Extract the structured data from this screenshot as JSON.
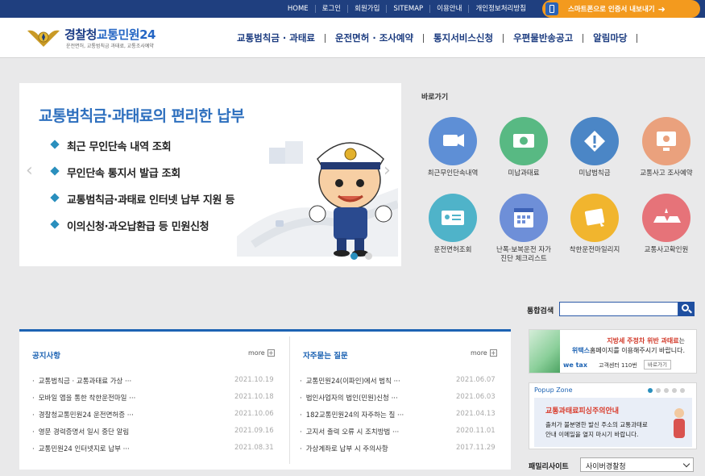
{
  "topbar": {
    "links": [
      "HOME",
      "로그인",
      "회원가입",
      "SITEMAP",
      "이용안내",
      "개인정보처리방침"
    ],
    "phone_cta": "스마트폰으로 인증서 내보내기"
  },
  "header": {
    "logo_main": "경찰청",
    "logo_accent": "교통민원24",
    "logo_sub": "운전면허, 교통범칙금 과태료, 교통조사예약",
    "nav": [
      "교통범칙금 · 과태료",
      "운전면허 · 조사예약",
      "통지서비스신청",
      "우편물반송공고",
      "알림마당"
    ]
  },
  "banner": {
    "title": "교통범칙금·과태료의 편리한 납부",
    "items": [
      "최근 무인단속 내역 조회",
      "무인단속 통지서 발급 조회",
      "교통범칙금·과태료 인터넷 납부 지원 등",
      "이의신청·과오납환급 등 민원신청"
    ]
  },
  "quick": {
    "title": "바로가기",
    "items": [
      {
        "label": "최근무인단속내역",
        "color": "#5e8fd6"
      },
      {
        "label": "미납과태료",
        "color": "#58b983"
      },
      {
        "label": "미납범칙금",
        "color": "#4b86c6"
      },
      {
        "label": "교통사고 조사예약",
        "color": "#eaa17d"
      },
      {
        "label": "운전면허조회",
        "color": "#4fb3c9"
      },
      {
        "label": "난폭·보복운전 자가진단 체크리스트",
        "color": "#6e8fd8"
      },
      {
        "label": "착한운전마일리지",
        "color": "#f1b52e"
      },
      {
        "label": "교통사고확인원",
        "color": "#e67379"
      }
    ]
  },
  "search": {
    "label": "통합검색",
    "placeholder": ""
  },
  "notice": {
    "title": "공지사항",
    "more": "more",
    "rows": [
      {
        "title": "교통범칙금 · 교통과태료 가상 ···",
        "date": "2021.10.19"
      },
      {
        "title": "모바일 앱을 통한 착한운전마일 ···",
        "date": "2021.10.18"
      },
      {
        "title": "경찰청교통민원24 운전면허증 ···",
        "date": "2021.10.06"
      },
      {
        "title": "영문 경력증명서 일시 중단 알림",
        "date": "2021.09.16"
      },
      {
        "title": "교통민원24 인터넷지로 납부 ···",
        "date": "2021.08.31"
      }
    ]
  },
  "faq": {
    "title": "자주묻는 질문",
    "more": "more",
    "rows": [
      {
        "title": "교통민원24(이파인)에서 범칙 ···",
        "date": "2021.06.07"
      },
      {
        "title": "법인사업자의 법인(민원)신청 ···",
        "date": "2021.06.03"
      },
      {
        "title": "182교통민원24의 자주하는 질 ···",
        "date": "2021.04.13"
      },
      {
        "title": "고지서 출력 오류 시 조치방법 ···",
        "date": "2020.11.01"
      },
      {
        "title": "가상계좌로 납부 시 주의사항",
        "date": "2017.11.29"
      }
    ]
  },
  "ad": {
    "line1_red": "지방세 주정차 위반 과태료",
    "line1_rest": "는",
    "line2_blue": "위택스",
    "line2_rest": "홈페이지를 이용해주시기 바랍니다.",
    "brand": "we tax",
    "tel": "고객센터 110번",
    "go": "바로가기"
  },
  "popup": {
    "zone": "Popup Zone",
    "headline": "교통과태료피싱주의안내",
    "line1": "출처가 불분명한 발신 주소의 교통과태료",
    "line2": "안내 이메일을 열지 마시기 바랍니다."
  },
  "family": {
    "label": "패밀리사이트",
    "selected": "사이버경찰청"
  }
}
